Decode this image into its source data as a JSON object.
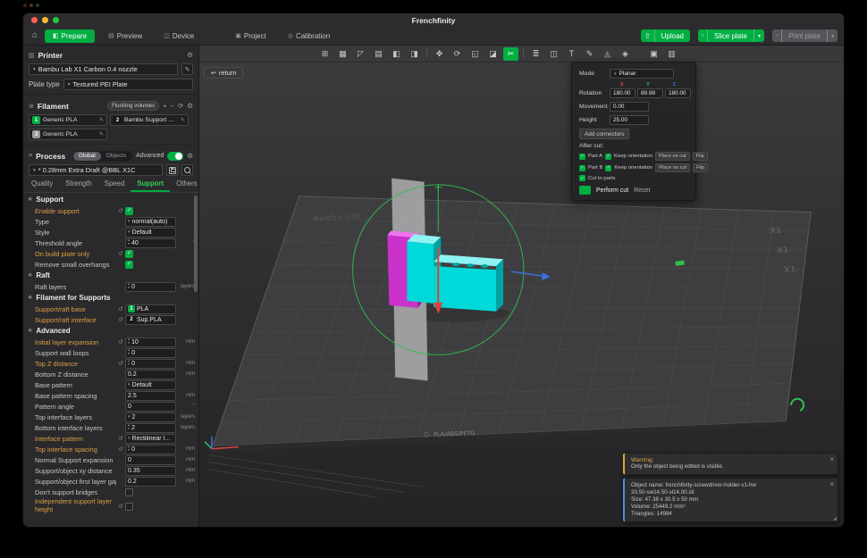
{
  "colors": {
    "accent": "#00ae42",
    "green_light": "#2fbf4f",
    "modified": "#dd9f43",
    "warn": "#e0a33e",
    "info": "#4a90d9",
    "cyan": "#00d9d9",
    "cyan_top": "#8ef3f3",
    "cyan_dark": "#00a3a3",
    "magenta": "#cb32cb",
    "magenta_top": "#ef74ef",
    "magenta_dark": "#8f1f8f",
    "axis_x": "#e04338",
    "axis_y": "#35c05a",
    "axis_z": "#3f6fdd",
    "plane": "#b4b4b6",
    "tl_red": "#ff5f57",
    "tl_yellow": "#febc2e",
    "tl_green": "#28c840"
  },
  "titlebar": {
    "title": "Frenchfinity"
  },
  "toolbar": {
    "tabs": [
      {
        "label": "Prepare",
        "icon": "◧",
        "active": true
      },
      {
        "label": "Preview",
        "icon": "▤"
      },
      {
        "label": "Device",
        "icon": "◫"
      },
      {
        "label": "Project",
        "icon": "▣",
        "far": true
      },
      {
        "label": "Calibration",
        "icon": "◎"
      }
    ],
    "upload": {
      "label": "Upload"
    },
    "slice": {
      "label": "Slice plate"
    },
    "print": {
      "label": "Print plate"
    }
  },
  "sidebar": {
    "printer": {
      "title": "Printer",
      "name": "Bambu Lab X1 Carbon 0.4 nozzle",
      "plate_type_label": "Plate type",
      "plate_type": "Textured PEI Plate"
    },
    "filament": {
      "title": "Filament",
      "flushing": "Flushing volumes",
      "slots": [
        {
          "num": "1",
          "name": "Generic PLA",
          "color": "#00ae42",
          "text": "#ffffff"
        },
        {
          "num": "2",
          "name": "Bambu Support For ...",
          "color": "#161616",
          "text": "#ffffff"
        },
        {
          "num": "3",
          "name": "Generic PLA",
          "color": "#9b9b9b",
          "text": "#ffffff"
        }
      ]
    },
    "process": {
      "title": "Process",
      "seg": [
        "Global",
        "Objects"
      ],
      "advanced": "Advanced",
      "preset": "* 0.28mm Extra Draft @BBL X1C"
    },
    "tabs": [
      {
        "label": "Quality"
      },
      {
        "label": "Strength"
      },
      {
        "label": "Speed"
      },
      {
        "label": "Support",
        "active": true
      },
      {
        "label": "Others"
      }
    ],
    "groups": [
      {
        "title": "Support",
        "rows": [
          {
            "label": "Enable support",
            "type": "checkbox",
            "checked": true,
            "modified": true,
            "revert": true
          },
          {
            "label": "Type",
            "type": "select",
            "value": "normal(auto)"
          },
          {
            "label": "Style",
            "type": "select",
            "value": "Default"
          },
          {
            "label": "Threshold angle",
            "type": "spin",
            "value": "40",
            "unit": "°"
          },
          {
            "label": "On build plate only",
            "type": "checkbox",
            "checked": true,
            "modified": true,
            "revert": true
          },
          {
            "label": "Remove small overhangs",
            "type": "checkbox",
            "checked": true
          }
        ]
      },
      {
        "title": "Raft",
        "rows": [
          {
            "label": "Raft layers",
            "type": "spin",
            "value": "0",
            "unit": "layers"
          }
        ]
      },
      {
        "title": "Filament for Supports",
        "rows": [
          {
            "label": "Support/raft base",
            "type": "filament",
            "value": "PLA",
            "badge": {
              "num": "1",
              "color": "#00ae42"
            },
            "modified": true,
            "revert": true
          },
          {
            "label": "Support/raft interface",
            "type": "filament",
            "value": "Sup.PLA",
            "badge": {
              "num": "2",
              "color": "#161616"
            },
            "modified": true,
            "revert": true
          }
        ]
      },
      {
        "title": "Advanced",
        "rows": [
          {
            "label": "Initial layer expansion",
            "type": "spin",
            "value": "10",
            "unit": "mm",
            "modified": true,
            "revert": true
          },
          {
            "label": "Support wall loops",
            "type": "spin",
            "value": "0",
            "unit": ""
          },
          {
            "label": "Top Z distance",
            "type": "spin",
            "value": "0",
            "unit": "mm",
            "modified": true,
            "revert": true
          },
          {
            "label": "Bottom Z distance",
            "type": "input",
            "value": "0.2",
            "unit": "mm"
          },
          {
            "label": "Base pattern",
            "type": "select",
            "value": "Default"
          },
          {
            "label": "Base pattern spacing",
            "type": "input",
            "value": "2.5",
            "unit": "mm"
          },
          {
            "label": "Pattern angle",
            "type": "input",
            "value": "0",
            "unit": "°"
          },
          {
            "label": "Top interface layers",
            "type": "select",
            "value": "2",
            "unit": "layers"
          },
          {
            "label": "Bottom interface layers",
            "type": "spin",
            "value": "2",
            "unit": "layers"
          },
          {
            "label": "Interface pattern",
            "type": "select",
            "value": "Rectilinear I...",
            "modified": true,
            "revert": true
          },
          {
            "label": "Top interface spacing",
            "type": "spin",
            "value": "0",
            "unit": "mm",
            "modified": true,
            "revert": true
          },
          {
            "label": "Normal Support expansion",
            "type": "input",
            "value": "0",
            "unit": "mm"
          },
          {
            "label": "Support/object xy distance",
            "type": "input",
            "value": "0.35",
            "unit": "mm"
          },
          {
            "label": "Support/object first layer gap",
            "type": "input",
            "value": "0.2",
            "unit": "mm"
          },
          {
            "label": "Don't support bridges",
            "type": "checkbox",
            "checked": false
          },
          {
            "label": "Independent support layer height",
            "type": "checkbox",
            "checked": false,
            "modified": true,
            "revert": true,
            "two": true
          }
        ]
      }
    ]
  },
  "viewport": {
    "return_label": "return",
    "tools": [
      {
        "name": "add-object-tool",
        "g": "⊞"
      },
      {
        "name": "add-plate-tool",
        "g": "▦"
      },
      {
        "name": "auto-orient-tool",
        "g": "◸"
      },
      {
        "name": "arrange-tool",
        "g": "▤"
      },
      {
        "name": "split-to-objects-tool",
        "g": "◧"
      },
      {
        "name": "split-to-parts-tool",
        "g": "◨"
      },
      {
        "sep": true
      },
      {
        "name": "move-tool",
        "g": "✥"
      },
      {
        "name": "rotate-tool",
        "g": "⟳"
      },
      {
        "name": "scale-tool",
        "g": "◱"
      },
      {
        "name": "flatten-tool",
        "g": "◪"
      },
      {
        "name": "cut-tool",
        "g": "✂",
        "active": true
      },
      {
        "sep": true
      },
      {
        "name": "variable-layer-height-tool",
        "g": "≣"
      },
      {
        "name": "mesh-boolean-tool",
        "g": "◫"
      },
      {
        "name": "text-tool",
        "g": "T"
      },
      {
        "name": "paint-tool",
        "g": "✎"
      },
      {
        "name": "support-paint-tool",
        "g": "◬"
      },
      {
        "name": "seam-tool",
        "g": "◈"
      },
      {
        "name": "assembly-view-tool",
        "g": "▣",
        "gap": true
      },
      {
        "name": "plate-settings-tool",
        "g": "▥"
      }
    ],
    "cut_panel": {
      "mode_label": "Mode",
      "mode": "Planar",
      "rotation_label": "Rotation",
      "axes": [
        {
          "l": "X",
          "c": "#e04338"
        },
        {
          "l": "Y",
          "c": "#35c05a"
        },
        {
          "l": "Z",
          "c": "#3f6fdd"
        }
      ],
      "rotation": [
        "180.00",
        "89.98",
        "180.00"
      ],
      "movement_label": "Movement",
      "movement": "0.00",
      "height_label": "Height",
      "height": "25.00",
      "add_connectors": "Add connectors",
      "after_cut": "After cut:",
      "parts": [
        {
          "label": "Part A",
          "keep": "Keep orientation",
          "place": "Place on cut",
          "flip": "Flip"
        },
        {
          "label": "Part B",
          "keep": "Keep orientation",
          "place": "Place on cut",
          "flip": "Flip"
        }
      ],
      "cut_to_parts": "Cut to parts",
      "perform": "Perform cut",
      "reset": "Reset"
    },
    "plate": {
      "brand": "Bambu Lab",
      "material": "PLA/ABS/PETG",
      "corner": "X1"
    },
    "toasts": [
      {
        "accent": "#e0a33e",
        "title": "Warning:",
        "lines": [
          "Only the object being edited is visible."
        ]
      },
      {
        "accent": "#4a90d9",
        "lines": [
          "Object name: frenchfinity-screwdriver-holder-v1-hw",
          "20.50-sw14.50-sl14.00.stl",
          "Size: 47.38 x 30.5 x 50 mm",
          "Volume: 25449.2 mm³",
          "Triangles: 14984"
        ],
        "resize": true
      }
    ]
  }
}
